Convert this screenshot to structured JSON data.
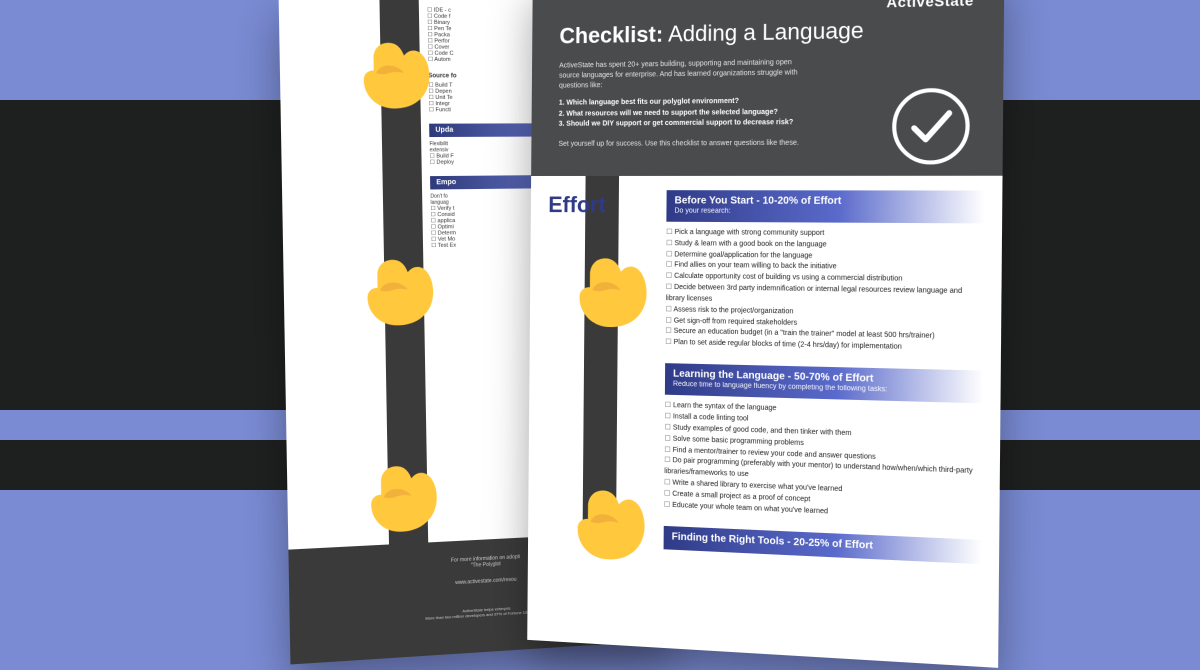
{
  "brand": "ActiveState",
  "title_prefix": "Checklist:",
  "title_main": "Adding a Language",
  "intro": "ActiveState has spent 20+ years building, supporting and maintaining open source languages for enterprise. And has learned organizations struggle with questions like:",
  "questions": [
    "1. Which language best fits our polyglot environment?",
    "2. What resources will we need to support the selected language?",
    "3. Should we DIY support or get commercial support to decrease risk?"
  ],
  "closing": "Set yourself up for success. Use this checklist to answer questions like these.",
  "effort_label": "Effort",
  "sections": [
    {
      "title": "Before You Start - 10-20% of Effort",
      "subtitle": "Do your research:",
      "items": [
        "Pick a language with strong community support",
        "Study & learn with a good book on the language",
        "Determine goal/application for the language",
        "Find allies on your team willing to back the initiative",
        "Calculate opportunity cost of building vs using a commercial distribution",
        "Decide between 3rd party indemnification or internal legal resources review language and library licenses",
        "Assess risk to the project/organization",
        "Get sign-off from required stakeholders",
        "Secure an education budget (in a \"train the trainer\" model at least 500 hrs/trainer)",
        "Plan to set aside regular blocks of time (2-4 hrs/day) for implementation"
      ]
    },
    {
      "title": "Learning the Language - 50-70% of Effort",
      "subtitle": "Reduce time to language fluency by completing the following tasks:",
      "items": [
        "Learn the syntax of the language",
        "Install a code linting tool",
        "Study examples of good code, and then tinker with them",
        "Solve some basic programming problems",
        "Find a mentor/trainer to review your code and answer questions",
        "Do pair programming (preferably with your mentor) to understand how/when/which third-party libraries/frameworks to use",
        "Write a shared library to exercise what you've learned",
        "Create a small project as a proof of concept",
        "Educate your whole team on what you've learned"
      ]
    },
    {
      "title": "Finding the Right Tools - 20-25% of Effort",
      "subtitle": "",
      "items": []
    }
  ],
  "back_page": {
    "truncated_items_1": [
      "IDE - c",
      "Code f",
      "Binary",
      "Pen Te",
      "Packa",
      "Perfor",
      "Cover",
      "Code C",
      "Autom"
    ],
    "heading1": "Source fo",
    "truncated_items_2": [
      "Build T",
      "Depen",
      "Unit Te",
      "Integr",
      "Functi"
    ],
    "band1_title": "Upda",
    "band1_sub": "Flexibilit\nextensiv",
    "truncated_items_3": [
      "Build F",
      "Deploy"
    ],
    "band2_title": "Empo",
    "band2_sub": "Don't fo\nlanguag",
    "truncated_items_4": [
      "Verify t",
      "Consid",
      "applica",
      "Optimi",
      "Determ",
      "Vet Mo",
      "Test Ex"
    ],
    "footer_line1": "For more information on adopti",
    "footer_line2": "\"The Polyglot",
    "footer_url": "www.activestate.com/resou",
    "footer_small1": "ActiveState helps enterpris",
    "footer_small2": "More than two million developers and 97% of Fortune 1000 compan"
  }
}
